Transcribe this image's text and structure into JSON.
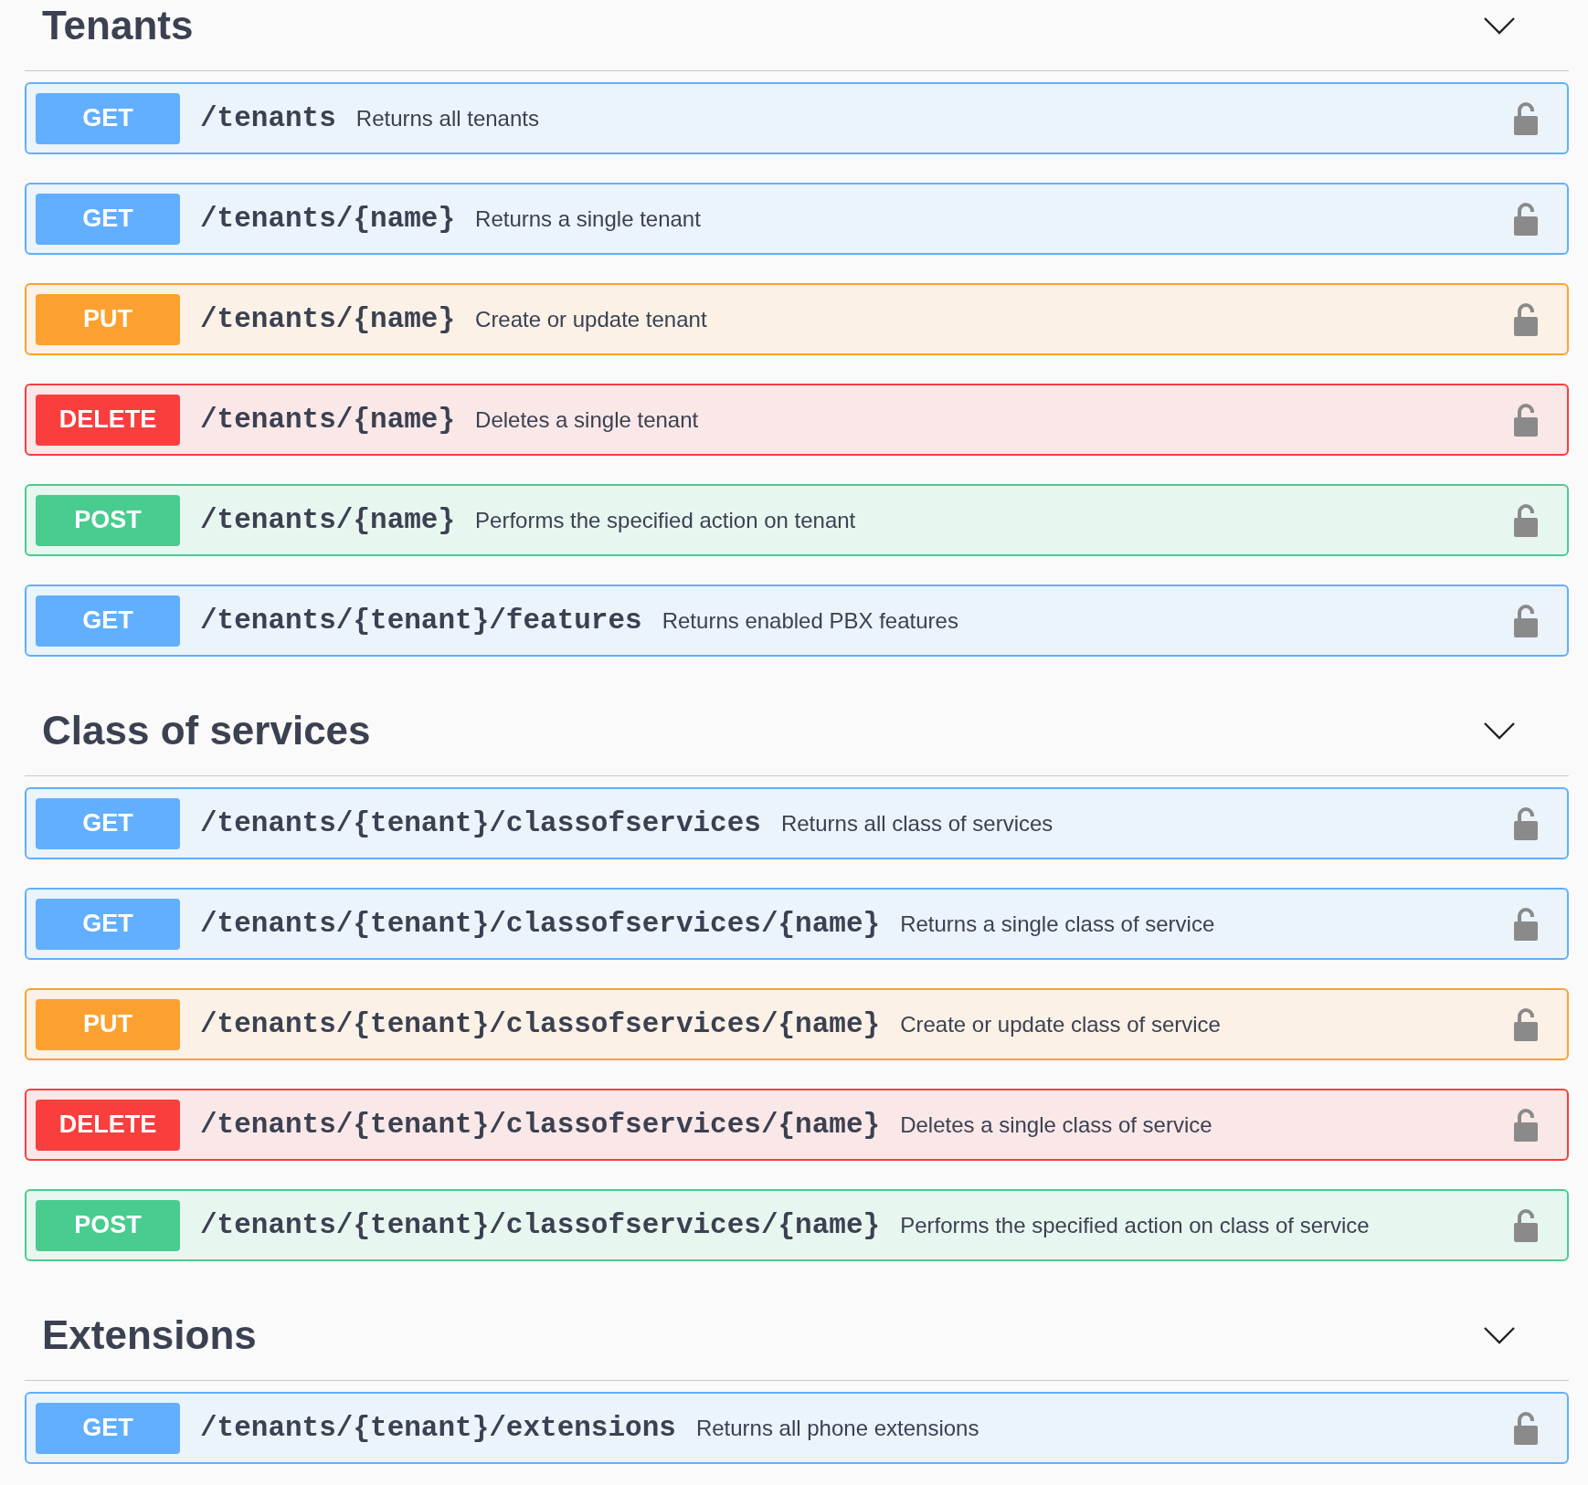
{
  "sections": [
    {
      "title": "Tenants",
      "expanded": true,
      "operations": [
        {
          "kind": "get",
          "method": "GET",
          "path": "/tenants",
          "summary": "Returns all tenants"
        },
        {
          "kind": "get",
          "method": "GET",
          "path": "/tenants/{name}",
          "summary": "Returns a single tenant"
        },
        {
          "kind": "put",
          "method": "PUT",
          "path": "/tenants/{name}",
          "summary": "Create or update tenant"
        },
        {
          "kind": "delete",
          "method": "DELETE",
          "path": "/tenants/{name}",
          "summary": "Deletes a single tenant"
        },
        {
          "kind": "post",
          "method": "POST",
          "path": "/tenants/{name}",
          "summary": "Performs the specified action on tenant"
        },
        {
          "kind": "get",
          "method": "GET",
          "path": "/tenants/{tenant}/features",
          "summary": "Returns enabled PBX features"
        }
      ]
    },
    {
      "title": "Class of services",
      "expanded": true,
      "operations": [
        {
          "kind": "get",
          "method": "GET",
          "path": "/tenants/{tenant}/classofservices",
          "summary": "Returns all class of services"
        },
        {
          "kind": "get",
          "method": "GET",
          "path": "/tenants/{tenant}/classofservices/{name}",
          "summary": "Returns a single class of service"
        },
        {
          "kind": "put",
          "method": "PUT",
          "path": "/tenants/{tenant}/classofservices/{name}",
          "summary": "Create or update class of service"
        },
        {
          "kind": "delete",
          "method": "DELETE",
          "path": "/tenants/{tenant}/classofservices/{name}",
          "summary": "Deletes a single class of service"
        },
        {
          "kind": "post",
          "method": "POST",
          "path": "/tenants/{tenant}/classofservices/{name}",
          "summary": "Performs the specified action on class of service"
        }
      ]
    },
    {
      "title": "Extensions",
      "expanded": true,
      "operations": [
        {
          "kind": "get",
          "method": "GET",
          "path": "/tenants/{tenant}/extensions",
          "summary": "Returns all phone extensions"
        }
      ]
    }
  ]
}
